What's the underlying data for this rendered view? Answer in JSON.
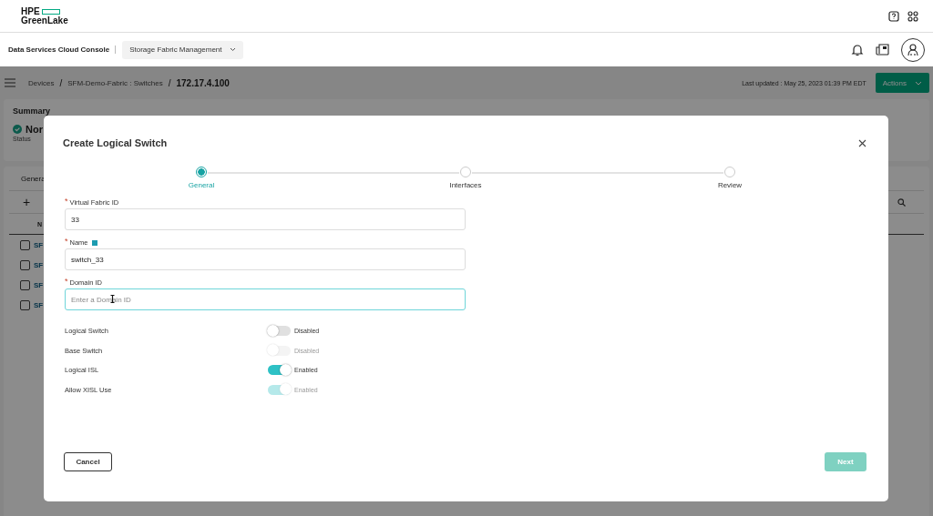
{
  "header": {
    "logo_top": "HPE",
    "logo_bottom": "GreenLake"
  },
  "subheader": {
    "app_title": "Data Services Cloud Console",
    "service": "Storage Fabric Management"
  },
  "breadcrumb": {
    "separator": "/",
    "items": [
      "Devices",
      "SFM-Demo-Fabric : Switches"
    ],
    "current": "172.17.4.100"
  },
  "last_updated": "Last updated :  May 25, 2023 01:39 PM EDT",
  "actions_button": "Actions",
  "summary": {
    "title": "Summary",
    "status_value": "Nor",
    "status_label": "Status"
  },
  "list": {
    "tab": "Genera",
    "add": "+",
    "column_1": "N",
    "rows": [
      {
        "name": "SF",
        "checked": false
      },
      {
        "name": "SF",
        "checked": false
      },
      {
        "name": "SF",
        "checked": false
      },
      {
        "name": "SF",
        "checked": false
      }
    ]
  },
  "dialog": {
    "title": "Create Logical Switch",
    "required_mark": "*",
    "steps": [
      {
        "label": "General",
        "selected": true
      },
      {
        "label": "Interfaces",
        "selected": false
      },
      {
        "label": "Review",
        "selected": false
      }
    ],
    "fields": [
      {
        "label": "Virtual Fabric ID",
        "required": true,
        "value": "33",
        "info": false,
        "focused": false
      },
      {
        "label": "Name",
        "required": true,
        "value": "switch_33",
        "info": true,
        "focused": false
      },
      {
        "label": "Domain ID",
        "required": true,
        "placeholder": "Enter a Domain ID",
        "info": false,
        "focused": true
      }
    ],
    "toggles": [
      {
        "label": "Logical Switch",
        "on": false,
        "disabled": false,
        "state_text": "Disabled"
      },
      {
        "label": "Base Switch",
        "on": false,
        "disabled": true,
        "state_text": "Disabled"
      },
      {
        "label": "Logical ISL",
        "on": true,
        "disabled": false,
        "state_text": "Enabled"
      },
      {
        "label": "Allow XISL Use",
        "on": true,
        "disabled": true,
        "state_text": "Enabled"
      }
    ],
    "cancel": "Cancel",
    "next": {
      "label": "Next",
      "disabled": true
    }
  }
}
